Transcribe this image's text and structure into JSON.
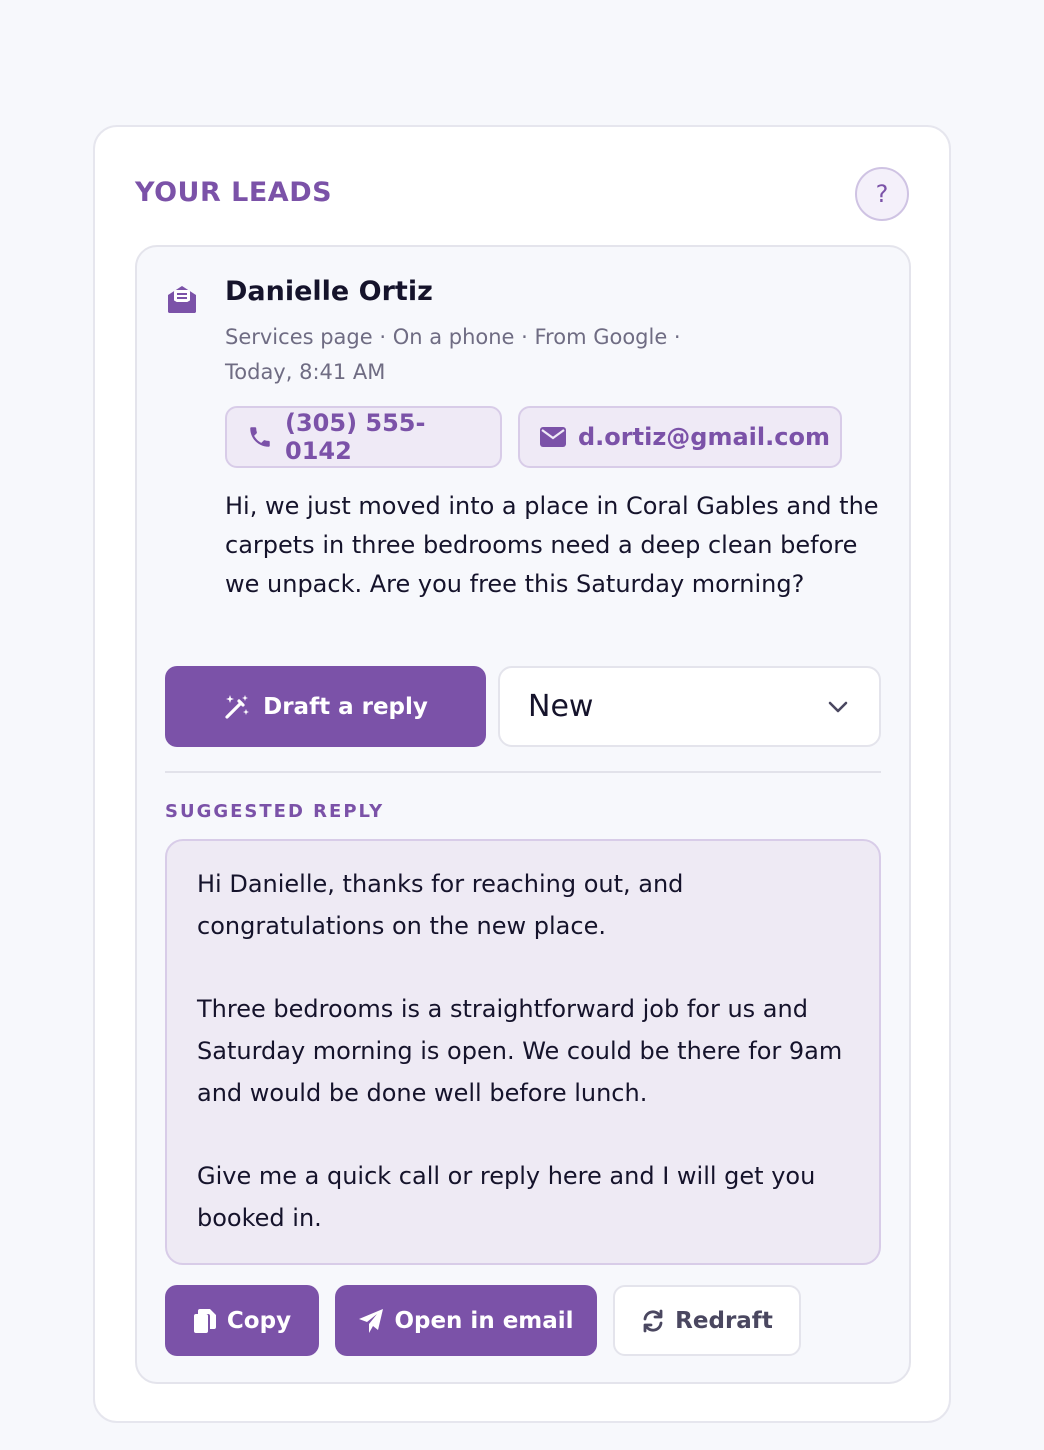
{
  "panel": {
    "title": "YOUR LEADS",
    "help_label": "?"
  },
  "lead": {
    "name": "Danielle Ortiz",
    "meta_line1": "Services page · On a phone · From Google ·",
    "meta_line2": "Today, 8:41 AM",
    "phone": "(305) 555-0142",
    "email": "d.ortiz@gmail.com",
    "message": "Hi, we just moved into a place in Coral Gables and the carpets in three bedrooms need a deep clean before we unpack. Are you free this Saturday morning?",
    "draft_button": "Draft a reply",
    "status_selected": "New"
  },
  "reply": {
    "section_label": "SUGGESTED REPLY",
    "paragraphs": [
      "Hi Danielle, thanks for reaching out, and congratulations on the new place.",
      "Three bedrooms is a straightforward job for us and Saturday morning is open. We could be there for 9am and would be done well before lunch.",
      "Give me a quick call or reply here and I will get you booked in."
    ],
    "copy_button": "Copy",
    "open_email_button": "Open in email",
    "redraft_button": "Redraft"
  },
  "icons": {
    "lead_type": "envelope-open-icon",
    "phone": "phone-icon",
    "email": "envelope-icon",
    "draft": "magic-wand-icon",
    "status": "chevron-down-icon",
    "copy": "copy-icon",
    "open_email": "paper-plane-icon",
    "redraft": "refresh-icon"
  },
  "colors": {
    "accent": "#7b52a8",
    "accent_tint": "#efeaf6",
    "page_background": "#f7f8fc",
    "text_primary": "#15132b",
    "text_muted": "#6f6c83"
  }
}
